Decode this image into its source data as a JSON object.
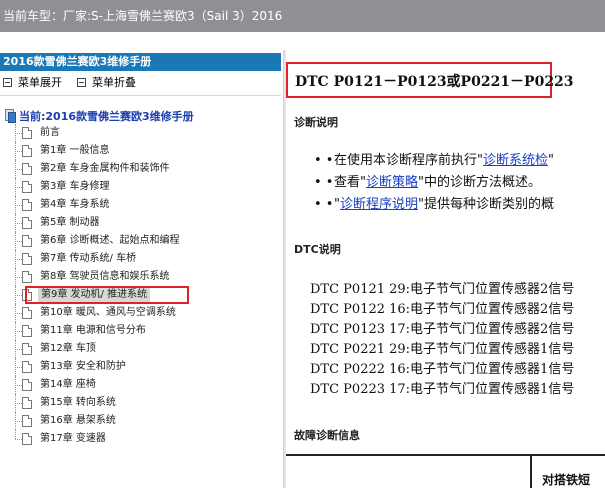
{
  "top_bar": {
    "label": "当前车型：",
    "value": "厂家:S-上海雪佛兰赛欧3（Sail 3）2016"
  },
  "left": {
    "header": "2016款雪佛兰赛欧3维修手册",
    "expand_label": "菜单展开",
    "collapse_label": "菜单折叠",
    "root_label": "当前:2016款雪佛兰赛欧3维修手册",
    "items": [
      "前言",
      "第1章 一般信息",
      "第2章 车身金属构件和装饰件",
      "第3章 车身修理",
      "第4章 车身系统",
      "第5章 制动器",
      "第6章 诊断概述、起始点和编程",
      "第7章 传动系统/ 车桥",
      "第8章 驾驶员信息和娱乐系统",
      "第9章 发动机/ 推进系统",
      "第10章 暖风、通风与空调系统",
      "第11章 电源和信号分布",
      "第12章 车顶",
      "第13章 安全和防护",
      "第14章 座椅",
      "第15章 转向系统",
      "第16章 悬架系统",
      "第17章 变速器"
    ],
    "selected_index": 9
  },
  "right": {
    "dtc_title": "DTC P0121－P0123或P0221－P0223",
    "diag_heading": "诊断说明",
    "bullets": [
      {
        "pre": "在使用本诊断程序前执行",
        "link": "诊断系统检",
        "post": ""
      },
      {
        "pre": "查看",
        "link": "诊断策略",
        "post": "中的诊断方法概述。"
      },
      {
        "pre": "",
        "link": "诊断程序说明",
        "post": "提供每种诊断类别的概"
      }
    ],
    "dtc_heading": "DTC说明",
    "dtc_rows": [
      "DTC P0121 29:电子节气门位置传感器2信号",
      "DTC P0122 16:电子节气门位置传感器2信号",
      "DTC P0123 17:电子节气门位置传感器2信号",
      "DTC P0221 29:电子节气门位置传感器1信号",
      "DTC P0222 16:电子节气门位置传感器1信号",
      "DTC P0223 17:电子节气门位置传感器1信号"
    ],
    "fault_heading": "故障诊断信息",
    "table_header": "对搭铁短"
  },
  "colors": {
    "header_blue": "#1b78b6",
    "highlight_red": "#e0202a",
    "link_blue": "#1a3fc0",
    "top_bar_gray": "#8e9095"
  }
}
